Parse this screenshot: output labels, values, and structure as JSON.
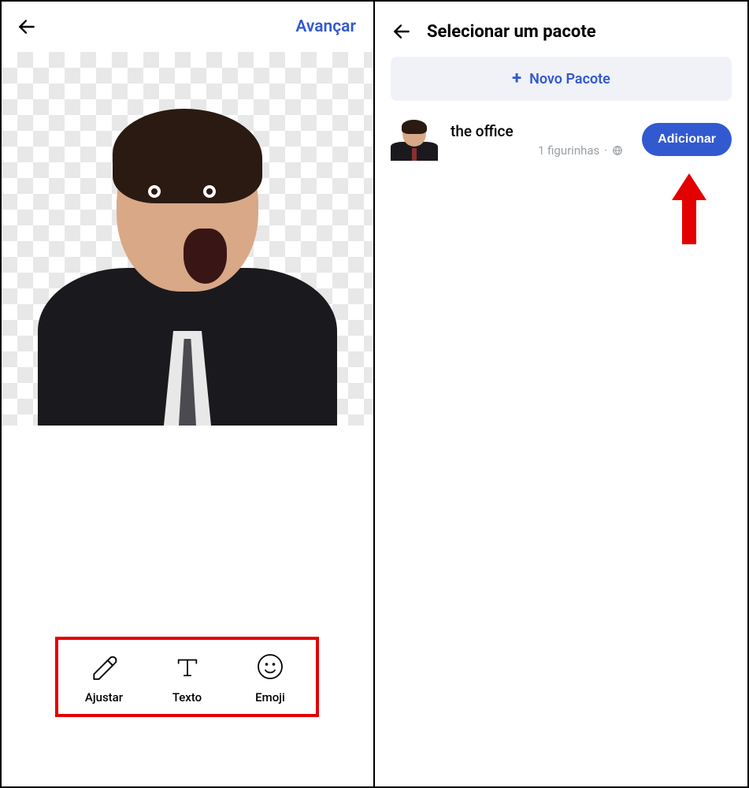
{
  "left": {
    "advance_label": "Avançar",
    "sticker_alt": "cutout of a man in a suit with an open mouth expression",
    "tools": {
      "adjust": "Ajustar",
      "text": "Texto",
      "emoji": "Emoji"
    }
  },
  "right": {
    "title": "Selecionar um pacote",
    "new_pack_label": "Novo Pacote",
    "pack": {
      "name": "the office",
      "subtitle": "1 figurinhas",
      "add_label": "Adicionar"
    }
  },
  "colors": {
    "accent": "#3259d0",
    "highlight": "#e30000"
  }
}
